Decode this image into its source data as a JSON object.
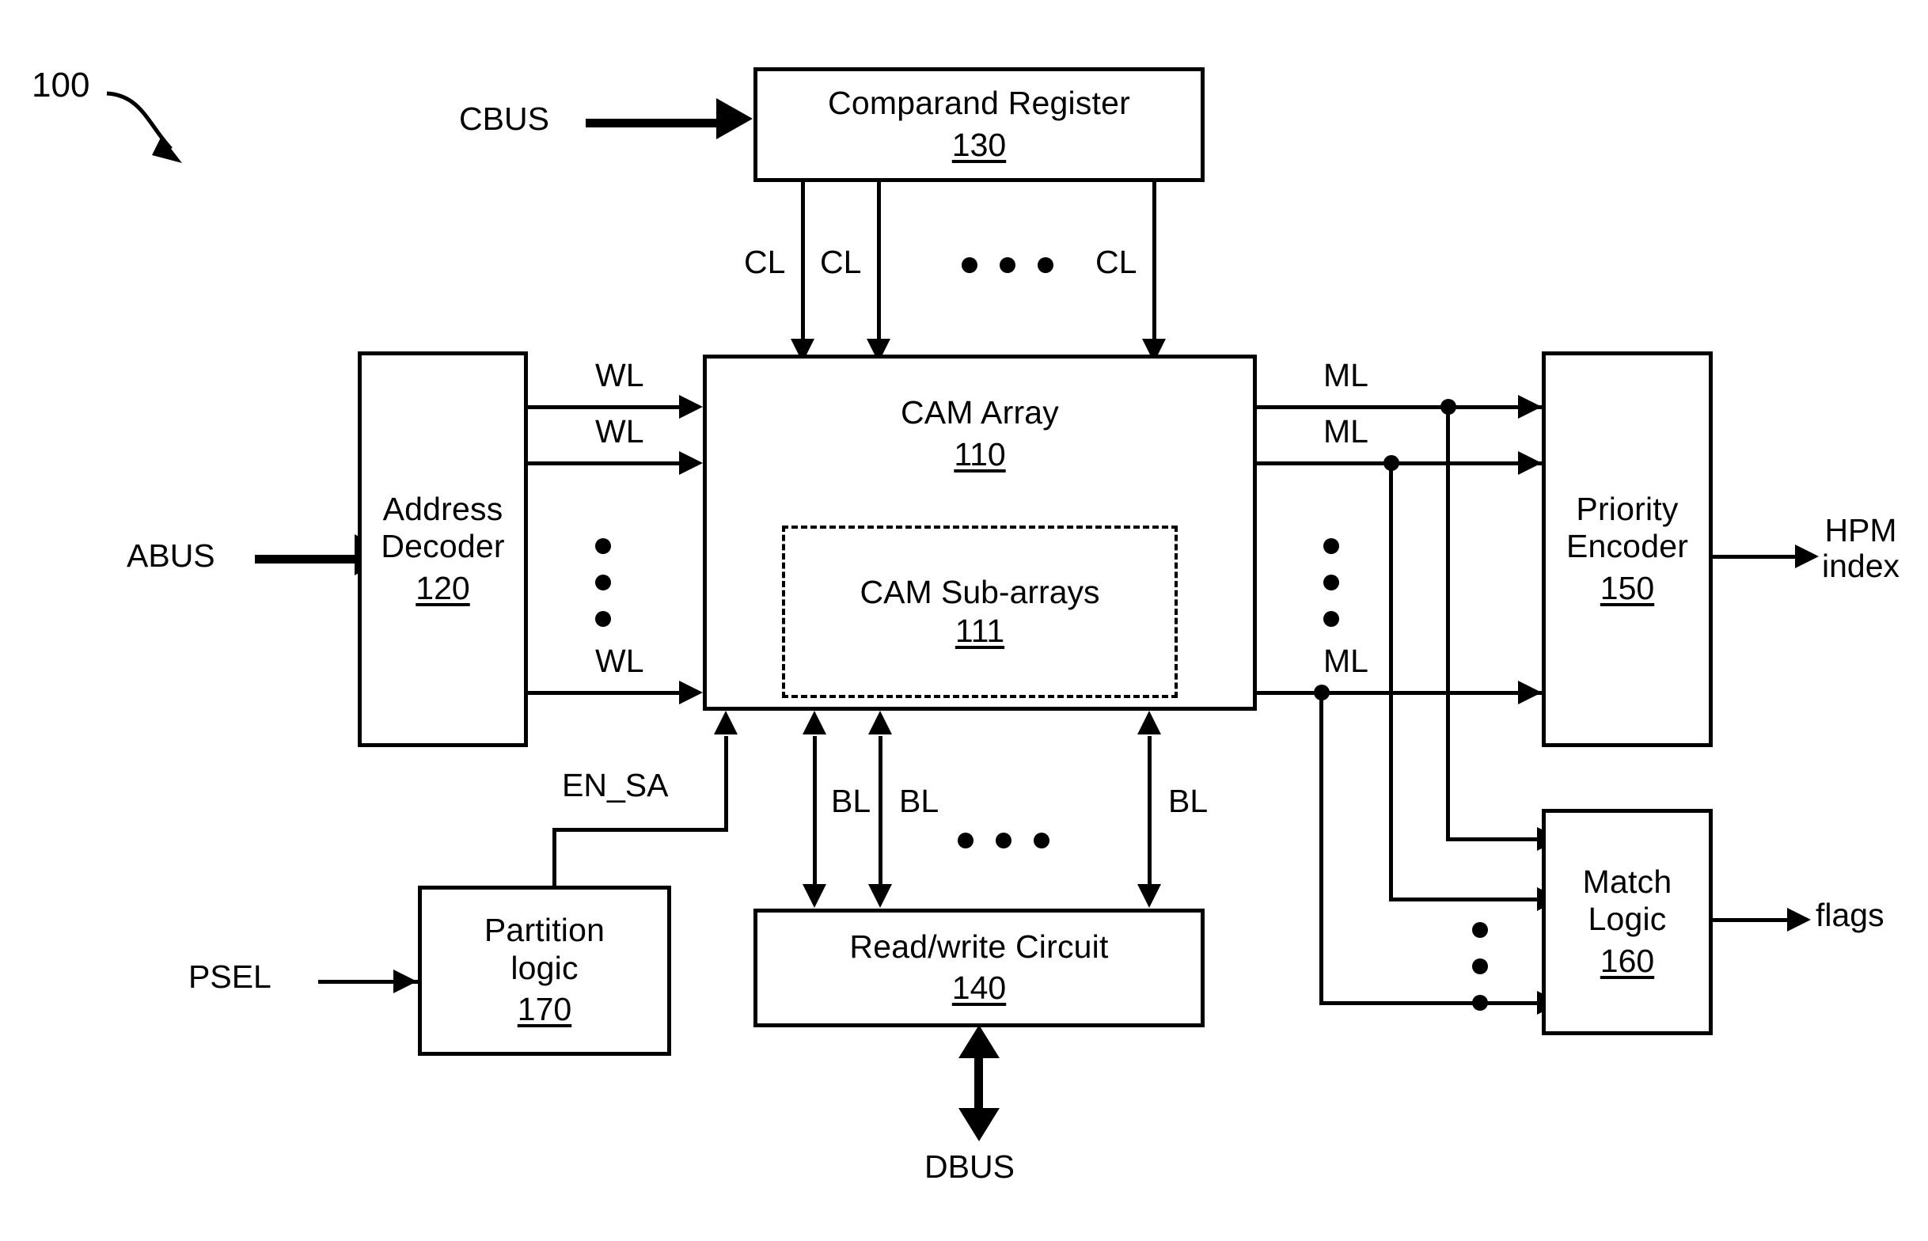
{
  "figure": {
    "reference_numeral": "100",
    "type": "patent-block-diagram",
    "description": "Content addressable memory (CAM) device block diagram"
  },
  "blocks": [
    {
      "id": "comparand_register",
      "title": "Comparand Register",
      "number": "130"
    },
    {
      "id": "cam_array",
      "title": "CAM Array",
      "number": "110"
    },
    {
      "id": "cam_subarrays",
      "title": "CAM Sub-arrays",
      "number": "111"
    },
    {
      "id": "address_decoder",
      "title": "Address\nDecoder",
      "number": "120"
    },
    {
      "id": "read_write_circuit",
      "title": "Read/write Circuit",
      "number": "140"
    },
    {
      "id": "priority_encoder",
      "title": "Priority\nEncoder",
      "number": "150"
    },
    {
      "id": "match_logic",
      "title": "Match\nLogic",
      "number": "160"
    },
    {
      "id": "partition_logic",
      "title": "Partition\nlogic",
      "number": "170"
    }
  ],
  "signals": {
    "cbus": "CBUS",
    "abus": "ABUS",
    "psel": "PSEL",
    "dbus": "DBUS",
    "en_sa": "EN_SA",
    "hpm_index": "HPM\nindex",
    "flags": "flags",
    "cl": [
      "CL",
      "CL",
      "CL"
    ],
    "wl": [
      "WL",
      "WL",
      "WL"
    ],
    "ml": [
      "ML",
      "ML",
      "ML"
    ],
    "bl": [
      "BL",
      "BL",
      "BL"
    ]
  },
  "colors": {
    "ink": "#000000",
    "paper": "#ffffff"
  }
}
